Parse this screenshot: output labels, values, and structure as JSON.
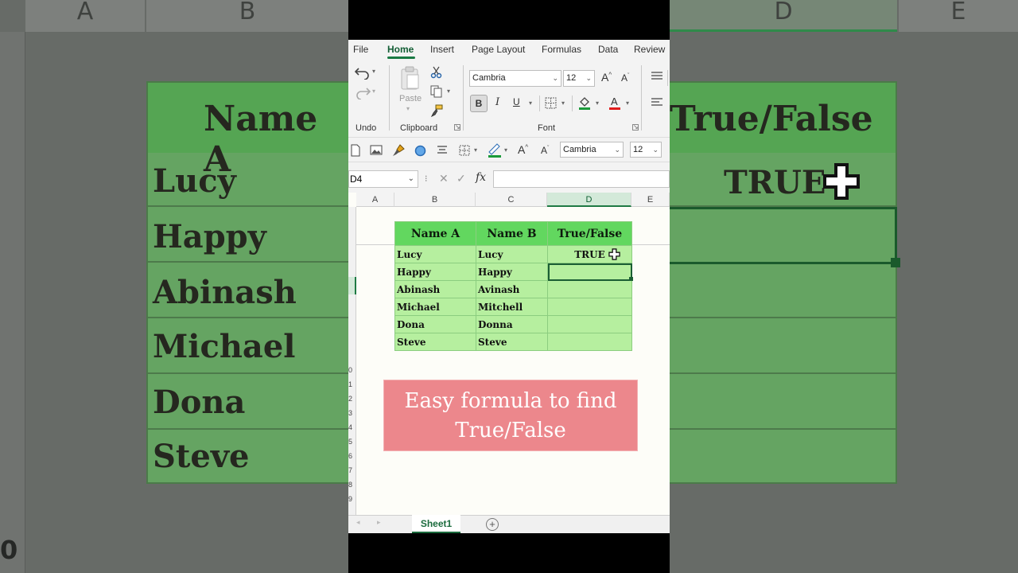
{
  "menu": {
    "tabs": [
      {
        "label": "File"
      },
      {
        "label": "Home"
      },
      {
        "label": "Insert"
      },
      {
        "label": "Page Layout"
      },
      {
        "label": "Formulas"
      },
      {
        "label": "Data"
      },
      {
        "label": "Review"
      }
    ],
    "active_tab": "Home"
  },
  "ribbon": {
    "undo_label": "Undo",
    "clipboard_label": "Clipboard",
    "paste_label": "Paste",
    "font_label": "Font",
    "font_name": "Cambria",
    "font_size": "12",
    "bold": "B",
    "italic": "I",
    "underline": "U",
    "font_color": "#e01b1b",
    "fill_color": "#1a9a3a"
  },
  "quick_toolbar": {
    "font_name": "Cambria",
    "font_size": "12",
    "fill_color": "#1a9a3a"
  },
  "formula_bar": {
    "name_box": "D4",
    "fx": "fx",
    "formula": ""
  },
  "columns": [
    "A",
    "B",
    "C",
    "D",
    "E"
  ],
  "selected_column": "D",
  "row_numbers": [
    "0",
    "1",
    "2",
    "3",
    "4",
    "5",
    "6",
    "7",
    "8",
    "9"
  ],
  "table": {
    "headers": [
      "Name A",
      "Name B",
      "True/False"
    ],
    "rows": [
      [
        "Lucy",
        "Lucy",
        "TRUE"
      ],
      [
        "Happy",
        "Happy",
        ""
      ],
      [
        "Abinash",
        "Avinash",
        ""
      ],
      [
        "Michael",
        "Mitchell",
        ""
      ],
      [
        "Dona",
        "Donna",
        ""
      ],
      [
        "Steve",
        "Steve",
        ""
      ]
    ]
  },
  "banner": {
    "line1": "Easy formula to find",
    "line2": "True/False",
    "color": "#ec878c"
  },
  "sheet_tabs": {
    "active": "Sheet1",
    "add": "+"
  },
  "background": {
    "col_left_a": "A",
    "col_left_b": "B",
    "col_right_d": "D",
    "col_right_e": "E",
    "left_header": "Name A",
    "right_header": "True/False",
    "left_names": [
      "Lucy",
      "Happy",
      "Abinash",
      "Michael",
      "Dona",
      "Steve"
    ],
    "right_value": "TRUE",
    "row_num_bottom": "0"
  },
  "colors": {
    "accent": "#1a7a44",
    "header_green": "#62d75f",
    "cell_green": "#b6ef9f"
  }
}
